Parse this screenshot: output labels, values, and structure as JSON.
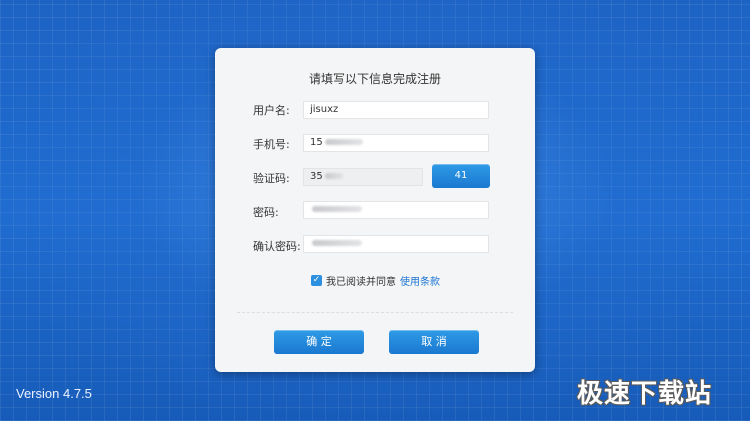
{
  "form": {
    "title": "请填写以下信息完成注册",
    "username_label": "用户名:",
    "username_value": "jisuxz",
    "phone_label": "手机号:",
    "phone_value": "15",
    "code_label": "验证码:",
    "code_value": "35",
    "code_button": "41",
    "password_label": "密码:",
    "confirm_label": "确认密码:",
    "agree_text": "我已阅读并同意",
    "terms_link": "使用条款",
    "agree_checked": true,
    "confirm_button": "确 定",
    "cancel_button": "取 消"
  },
  "version": "Version 4.7.5",
  "watermark": "极速下载站",
  "colors": {
    "background": "#1f68c9",
    "button": "#1f84d8",
    "link": "#1a73d0"
  }
}
